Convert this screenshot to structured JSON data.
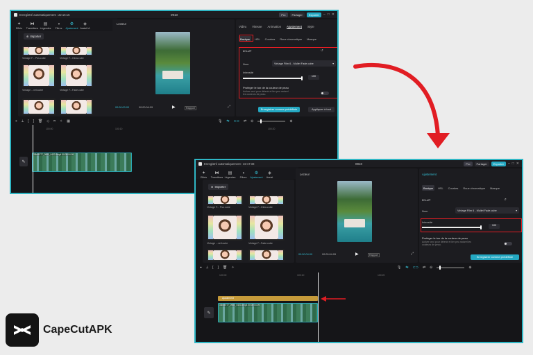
{
  "win1": {
    "autosave": "Enregistré automatiquement : 22:16:15",
    "title": "0910",
    "pro": "Pro",
    "share": "Partager",
    "export": "Exporter",
    "tools": [
      "Médias",
      "Audio",
      "Texte",
      "Autocollants",
      "Effets",
      "Transitions",
      "Légendes",
      "Filtres",
      "Ajustement",
      "Assist IA"
    ],
    "import": "Importer",
    "thumbs": [
      "Vintage F... Pss.cube",
      "Vintage F...Glow.cube",
      "Vintage ...vell.cube",
      "Vintage F...Fade.cube"
    ],
    "player": "Lecteur",
    "time_current": "00:00:00:00",
    "time_total": "00:00:04:09",
    "tabs": [
      "Vidéo",
      "Vitesse",
      "Animation",
      "Ajustement",
      "Style"
    ],
    "subtabs": [
      "Basique",
      "HSL",
      "Courbes",
      "Roue chromatique",
      "Masque"
    ],
    "lut": "LUT",
    "name_label": "Nom",
    "name_value": "Vintage Film 6 - Mullet Fade.cube",
    "intensity_label": "Intensité",
    "intensity_value": "100",
    "protect_label": "Protéger le ton de la couleur de peau",
    "protect_desc": "Activer ceci pour détenir et lier peu naturel les couleurs de peau.",
    "save_preset": "Enregistrer comme prédéfinie",
    "apply_all": "Appliquer à tout",
    "ratio": "Rapport",
    "ruler": [
      "100:00",
      "100:10",
      "100:20"
    ],
    "clip_name": "33b4EIT7_0980_0420.3mp4  00:00:04:09"
  },
  "win2": {
    "autosave": "Enregistré automatiquement : 22:17:33",
    "title": "0910",
    "pro": "Pro",
    "share": "Partager",
    "export": "Exporter",
    "tools": [
      "Médias",
      "Audio",
      "Texte",
      "Autocollants",
      "Effets",
      "Transitions",
      "Légendes",
      "Filtres",
      "Ajustement",
      "Assist"
    ],
    "import": "Importer",
    "thumbs": [
      "Vintage F... Pss.cube",
      "Vintage F...Glow.cube",
      "Vintage ...vell.cube",
      "Vintage F...Fade.cube"
    ],
    "player": "Lecteur",
    "time_current": "00:00:04:09",
    "time_total": "00:00:04:09",
    "panel_title": "Ajustement",
    "subtabs": [
      "Basique",
      "HSL",
      "Courbes",
      "Roue chromatique",
      "Masque"
    ],
    "lut": "LUT",
    "name_label": "Nom",
    "name_value": "Vintage Film 6 - Mullet Fade.cube",
    "intensity_label": "Intensité",
    "intensity_value": "100",
    "protect_label": "Protéger le ton de la couleur de peau",
    "protect_desc": "Activer ceci pour détenir et lier peu naturel les couleurs de peau.",
    "save_preset": "Enregistrer comme prédéfinie",
    "ratio": "Rapport",
    "ruler": [
      "100:00",
      "100:10",
      "100:20"
    ],
    "adj_clip": "Ajustement",
    "clip_name": "33b4EIT7_0980_0420.3mp4  00:00:04:09"
  },
  "brand": {
    "name": "CapeCutAPK"
  },
  "colors": {
    "accent": "#2fb7c5",
    "highlight": "#e11d23",
    "adjust_clip": "#c59a3a"
  }
}
